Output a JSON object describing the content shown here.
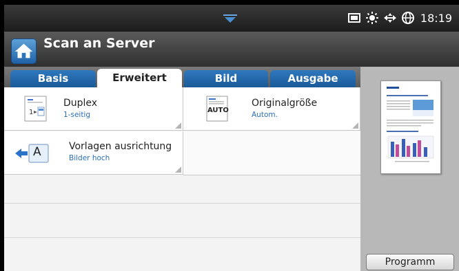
{
  "status_bar": {
    "time": "18:19"
  },
  "header": {
    "title": "Scan an Server"
  },
  "tabs": [
    {
      "label": "Basis",
      "active": false
    },
    {
      "label": "Erweitert",
      "active": true
    },
    {
      "label": "Bild",
      "active": false
    },
    {
      "label": "Ausgabe",
      "active": false
    }
  ],
  "options": [
    {
      "label": "Duplex",
      "value": "1-seitig",
      "icon": "duplex-icon"
    },
    {
      "label": "Originalgröße",
      "value": "Autom.",
      "icon": "auto-size-icon",
      "icon_text": "AUTO"
    },
    {
      "label": "Vorlagen ausrichtung",
      "value": "Bilder hoch",
      "icon": "orientation-icon",
      "icon_text": "A"
    }
  ],
  "right_panel": {
    "program_label": "Programm"
  },
  "colors": {
    "accent": "#2a6fb8",
    "tab_blue": "#1a5a99"
  }
}
